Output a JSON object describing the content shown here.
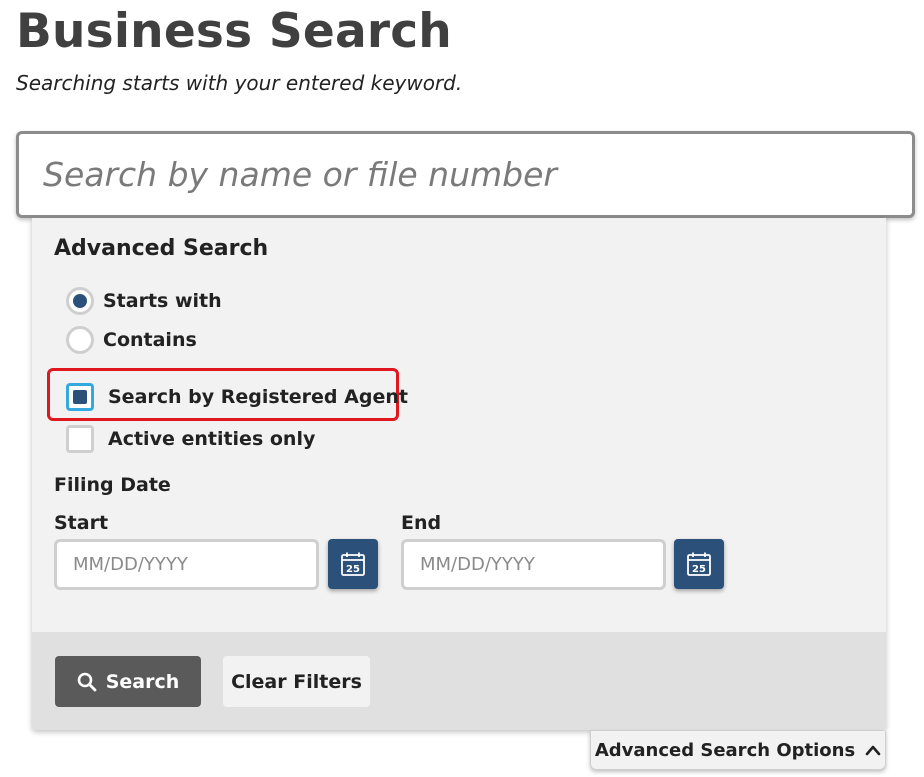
{
  "header": {
    "title": "Business Search",
    "subtitle": "Searching starts with your entered keyword."
  },
  "search": {
    "placeholder": "Search by name or file number",
    "value": ""
  },
  "advanced": {
    "title": "Advanced Search",
    "match_options": [
      {
        "label": "Starts with",
        "selected": true
      },
      {
        "label": "Contains",
        "selected": false
      }
    ],
    "registered_agent": {
      "label": "Search by Registered Agent",
      "checked": true
    },
    "active_only": {
      "label": "Active entities only",
      "checked": false
    },
    "filing_date": {
      "label": "Filing Date",
      "start": {
        "label": "Start",
        "placeholder": "MM/DD/YYYY",
        "calendar_icon": "calendar-icon",
        "calendar_day": "25"
      },
      "end": {
        "label": "End",
        "placeholder": "MM/DD/YYYY",
        "calendar_icon": "calendar-icon",
        "calendar_day": "25"
      }
    },
    "buttons": {
      "search_label": "Search",
      "search_icon": "magnifier-icon",
      "clear_label": "Clear Filters"
    },
    "toggle_label": "Advanced Search Options",
    "toggle_icon": "chevron-up-icon"
  },
  "colors": {
    "title_gray": "#404040",
    "accent_navy": "#2b517a",
    "focus_blue": "#33a9e0",
    "highlight_red": "#e0171f",
    "search_button_gray": "#5a5a5a"
  }
}
